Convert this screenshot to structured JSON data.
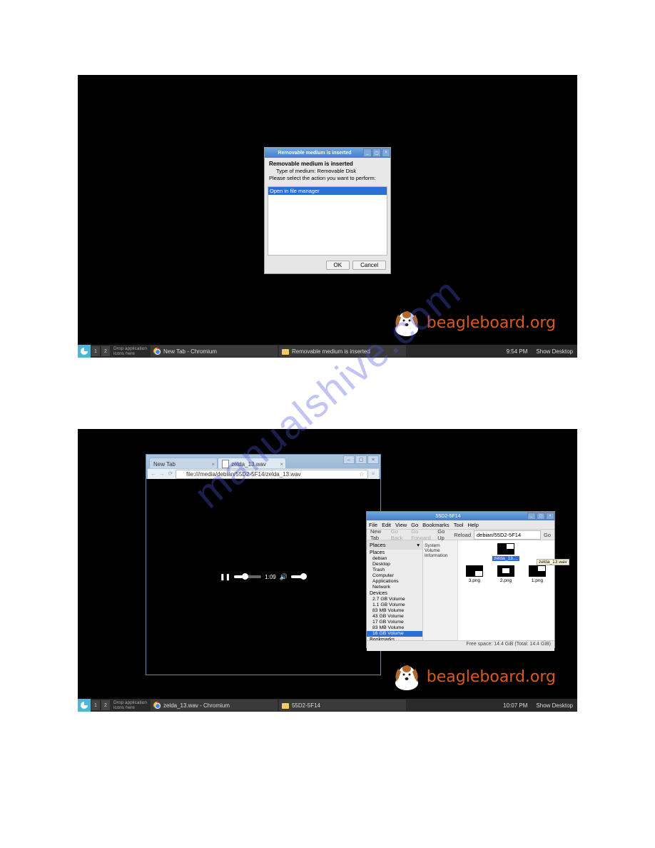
{
  "watermark": "manualshive.com",
  "logo_text": "beagleboard.org",
  "screenshot1": {
    "taskbar": {
      "ws1": "1",
      "ws2": "2",
      "drop_hint": "Drop application\nicons here",
      "task1": "New Tab - Chromium",
      "task2": "Removable medium is inserted",
      "clock": "9:54 PM",
      "show_desktop": "Show Desktop"
    },
    "dialog": {
      "title": "Removable medium is inserted",
      "heading": "Removable medium is inserted",
      "type_label": "Type of medium: Removable Disk",
      "prompt": "Please select the action you want to perform:",
      "selected_action": "Open in file manager",
      "ok": "OK",
      "cancel": "Cancel"
    }
  },
  "screenshot2": {
    "taskbar": {
      "ws1": "1",
      "ws2": "2",
      "drop_hint": "Drop application\nicons here",
      "task1": "zelda_13.wav - Chromium",
      "task2": "55D2-5F14",
      "clock": "10:07 PM",
      "show_desktop": "Show Desktop"
    },
    "chrome": {
      "tab1": "New Tab",
      "tab2": "zelda_13.wav",
      "url": "file:///media/debian/55D2-5F14/zelda_13.wav",
      "media_time": "1:09"
    },
    "fm": {
      "title": "55D2-5F14",
      "menu": [
        "File",
        "Edit",
        "View",
        "Go",
        "Bookmarks",
        "Tool",
        "Help"
      ],
      "tb_newtab": "New Tab",
      "tb_goback": "Go Back",
      "tb_gofwd": "Go Forward",
      "tb_goup": "Go Up",
      "tb_reload": "Reload",
      "tb_path": "debian/55D2-5F14",
      "tb_go": "Go",
      "side_header": "Places",
      "places": [
        "Places",
        "debian",
        "Desktop",
        "Trash",
        "Computer",
        "Applications",
        "Network"
      ],
      "devices_label": "Devices",
      "devices": [
        "2.7 GB Volume",
        "1.1 GB Volume",
        "83 MB Volume",
        "43 GB Volume",
        "17 GB Volume",
        "83 MB Volume",
        "16 GB Volume"
      ],
      "bookmarks_label": "Bookmarks",
      "info_labels": [
        "System",
        "Volume",
        "Information"
      ],
      "files": [
        {
          "name": "zelda_13....",
          "tooltip": "zelda_13.wav",
          "selected": true,
          "thumb_pos": "tr"
        },
        {
          "name": "3.png",
          "thumb_pos": "br"
        },
        {
          "name": "2.png",
          "thumb_pos": "c"
        },
        {
          "name": "1.png",
          "thumb_pos": "tr"
        }
      ],
      "status": "Free space: 14.4 GiB (Total: 14.4 GiB)"
    }
  }
}
